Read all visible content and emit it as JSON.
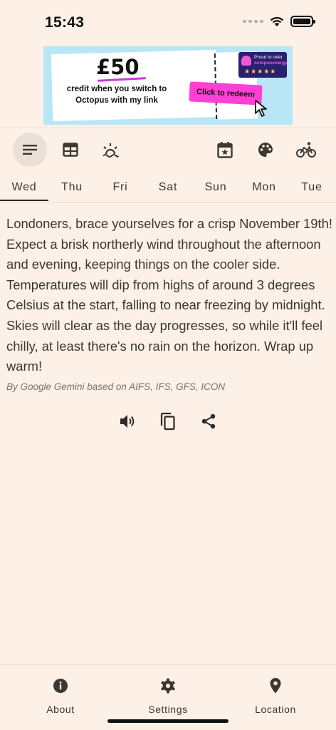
{
  "status_bar": {
    "time": "15:43"
  },
  "ad": {
    "amount": "£50",
    "text": "credit when you switch to Octopus with my link",
    "badge_line1": "Proud to refer",
    "badge_line2": "octopusenergy",
    "stars": "★★★★★",
    "cta": "Click to redeem"
  },
  "toolbar": {
    "left": [
      "summary-icon",
      "table-icon",
      "sunrise-icon"
    ],
    "right": [
      "calendar-star-icon",
      "palette-icon",
      "bike-icon"
    ]
  },
  "tabs": [
    "Wed",
    "Thu",
    "Fri",
    "Sat",
    "Sun",
    "Mon",
    "Tue"
  ],
  "active_tab": "Wed",
  "forecast": {
    "text": "Londoners, brace yourselves for a crisp November 19th! Expect a brisk northerly wind throughout the afternoon and evening, keeping things on the cooler side. Temperatures will dip from highs of around 3 degrees Celsius at the start, falling to near freezing by midnight. Skies will clear as the day progresses, so while it'll feel chilly, at least there's no rain on the horizon. Wrap up warm!",
    "attribution": "By Google Gemini based on AIFS, IFS, GFS, ICON"
  },
  "actions": [
    "speaker-icon",
    "copy-icon",
    "share-icon"
  ],
  "bottom_nav": [
    {
      "label": "About",
      "icon": "info-icon"
    },
    {
      "label": "Settings",
      "icon": "gear-icon"
    },
    {
      "label": "Location",
      "icon": "location-pin-icon"
    }
  ],
  "colors": {
    "background": "#fdf0e6",
    "text": "#3d3733",
    "accent_pink": "#ff3fd6",
    "ad_bg": "#b8e6f7"
  }
}
